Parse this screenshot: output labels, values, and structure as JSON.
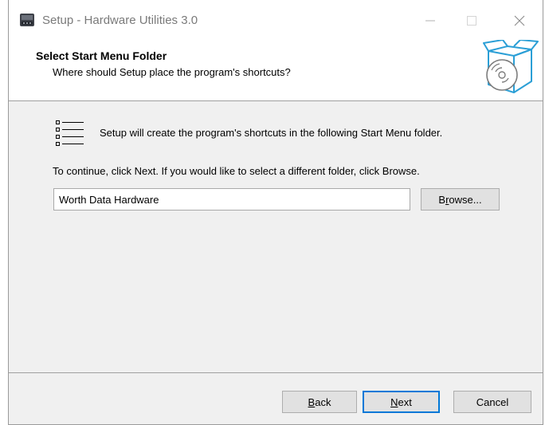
{
  "window": {
    "title": "Setup - Hardware Utilities 3.0",
    "controls": {
      "minimize_icon": "minimize-icon",
      "maximize_icon": "maximize-icon",
      "close_icon": "close-icon"
    }
  },
  "header": {
    "title": "Select Start Menu Folder",
    "subtitle": "Where should Setup place the program's shortcuts?",
    "icon": "software-box-cd-icon"
  },
  "content": {
    "info_text": "Setup will create the program's shortcuts in the following Start Menu folder.",
    "instruction_text": "To continue, click Next. If you would like to select a different folder, click Browse.",
    "folder_input_value": "Worth Data Hardware",
    "browse_button": {
      "mnemonic": "r",
      "before": "B",
      "after": "owse..."
    }
  },
  "footer": {
    "back_button": {
      "mnemonic": "B",
      "before": "",
      "after": "ack"
    },
    "next_button": {
      "mnemonic": "N",
      "before": "",
      "after": "ext"
    },
    "cancel_button": {
      "label": "Cancel"
    }
  },
  "colors": {
    "accent": "#0078d7",
    "background": "#f0f0f0",
    "header_bg": "#ffffff",
    "icon_blue": "#2b9fd6"
  }
}
